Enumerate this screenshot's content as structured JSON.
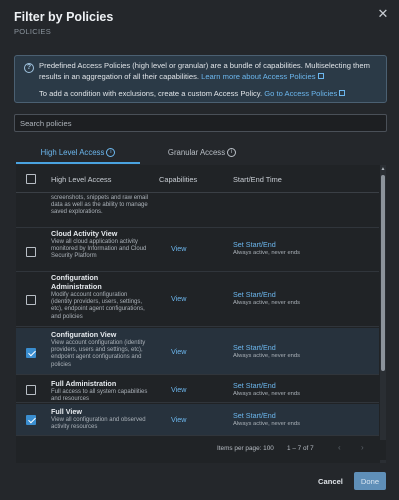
{
  "dialog": {
    "title": "Filter by Policies",
    "subtitle": "POLICIES",
    "close_glyph": "✕"
  },
  "info": {
    "text1": "Predefined Access Policies (high level or granular) are a bundle of capabilities. Multiselecting them results in an aggregation of all their capabilities.",
    "link1": "Learn more about Access Policies",
    "text2": "To add a condition with exclusions, create a custom Access Policy.",
    "link2": "Go to Access Policies",
    "icon": "question-icon"
  },
  "search": {
    "placeholder": "Search policies",
    "value": ""
  },
  "tabs": [
    {
      "label": "High Level Access",
      "active": true
    },
    {
      "label": "Granular Access",
      "active": false
    }
  ],
  "table": {
    "headers": {
      "name": "High Level Access",
      "capabilities": "Capabilities",
      "time": "Start/End Time"
    },
    "partial_row_desc": "screenshots, snippets and raw email data as well as the ability to manage saved explorations.",
    "rows": [
      {
        "name": "Cloud Activity View",
        "desc": "View all cloud application activity monitored by Information and Cloud Security Platform",
        "view": "View",
        "time": "Set Start/End",
        "time_sub": "Always active, never ends",
        "checked": false
      },
      {
        "name": "Configuration Administration",
        "desc": "Modify account configuration (identity providers, users, settings, etc), endpoint agent configurations, and policies",
        "view": "View",
        "time": "Set Start/End",
        "time_sub": "Always active, never ends",
        "checked": false
      },
      {
        "name": "Configuration View",
        "desc": "View account configuration (identity providers, users and settings, etc), endpoint agent configurations and policies",
        "view": "View",
        "time": "Set Start/End",
        "time_sub": "Always active, never ends",
        "checked": true
      },
      {
        "name": "Full Administration",
        "desc": "Full access to all system capabilities and resources",
        "view": "View",
        "time": "Set Start/End",
        "time_sub": "Always active, never ends",
        "checked": false
      },
      {
        "name": "Full View",
        "desc": "View all configuration and observed activity resources",
        "view": "View",
        "time": "Set Start/End",
        "time_sub": "Always active, never ends",
        "checked": true
      }
    ]
  },
  "pager": {
    "label": "Items per page: 100",
    "range": "1 – 7 of 7",
    "prev": "‹",
    "next": "›"
  },
  "footer": {
    "cancel": "Cancel",
    "done": "Done"
  },
  "colors": {
    "accent": "#4aa3e0",
    "link": "#6cb7ee",
    "selected_row": "#27323d",
    "done_button": "#5f8fb8"
  }
}
